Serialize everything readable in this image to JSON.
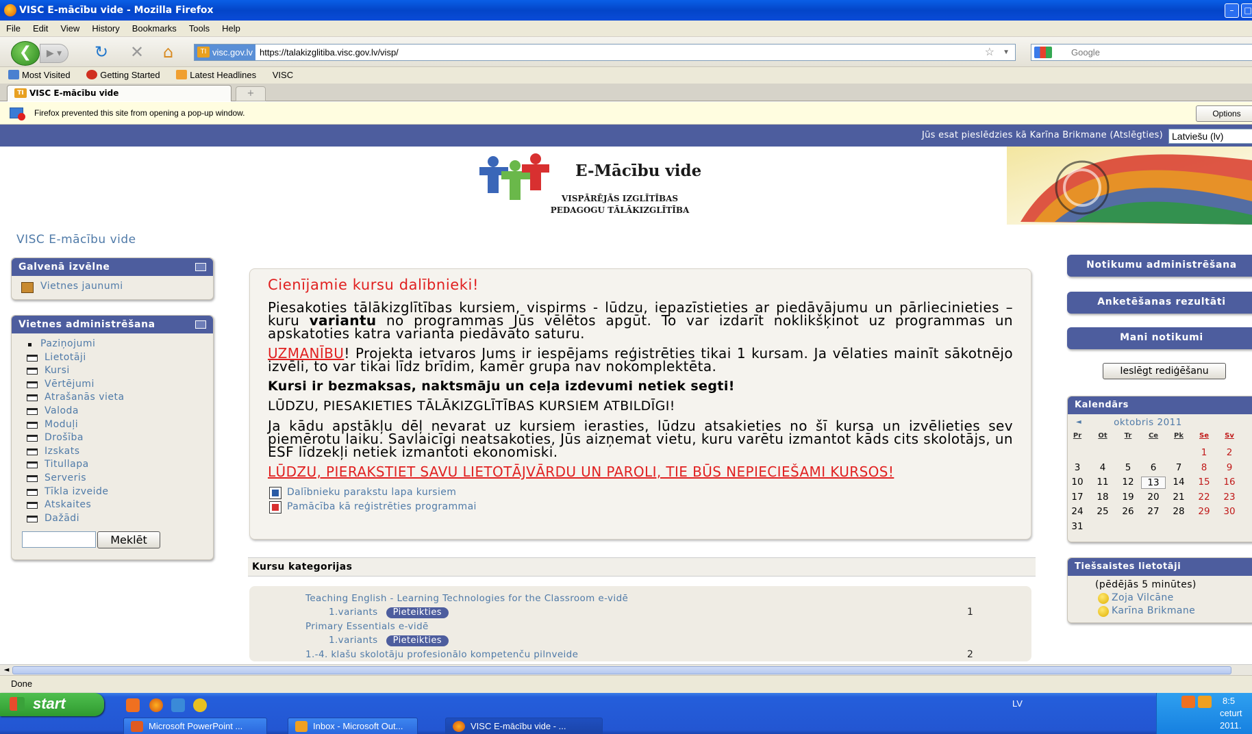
{
  "window": {
    "title": "VISC E-mācību vide - Mozilla Firefox"
  },
  "menubar": [
    "File",
    "Edit",
    "View",
    "History",
    "Bookmarks",
    "Tools",
    "Help"
  ],
  "navbar": {
    "site_badge": "visc.gov.lv",
    "url": "https://talakizglitiba.visc.gov.lv/visp/",
    "search_placeholder": "Google"
  },
  "bookmarks": [
    "Most Visited",
    "Getting Started",
    "Latest Headlines",
    "VISC"
  ],
  "tab": {
    "title": "VISC E-mācību vide",
    "new_tab": "+"
  },
  "popup": {
    "message": "Firefox prevented this site from opening a pop-up window.",
    "options_label": "Options"
  },
  "userbar": {
    "text": "Jūs esat pieslēdzies kā Karīna Brikmane (Atslēgties)",
    "language": "Latviešu (lv)"
  },
  "logo": {
    "title": "E-Mācību vide",
    "line1": "VISPĀRĒJĀS IZGLĪTĪBAS",
    "line2": "PEDAGOGU TĀLĀKIZGLĪTĪBA"
  },
  "site_title": "VISC E-mācību vide",
  "main_menu": {
    "title": "Galvenā izvēlne",
    "item": "Vietnes jaunumi"
  },
  "site_admin": {
    "title": "Vietnes administrēšana",
    "items": [
      "Paziņojumi",
      "Lietotāji",
      "Kursi",
      "Vērtējumi",
      "Atrašanās vieta",
      "Valoda",
      "Moduļi",
      "Drošība",
      "Izskats",
      "Titullapa",
      "Serveris",
      "Tīkla izveide",
      "Atskaites",
      "Dažādi"
    ],
    "search_button": "Meklēt"
  },
  "notice": {
    "heading": "Cienījamie kursu dalībnieki!",
    "p1_a": "Piesakoties tālākizglītības kursiem, vispirms - lūdzu, iepazīstieties ar piedāvājumu un pārliecinieties – kuru ",
    "p1_bold": "variantu",
    "p1_b": " no programmas Jūs vēlētos apgūt. To var izdarīt noklikšķinot uz programmas un apskatoties katra varianta piedāvāto saturu.",
    "p2_warn": "UZMANĪBU",
    "p2_rest": "! Projekta ietvaros Jums ir iespējams reģistrēties tikai 1 kursam. Ja vēlaties mainīt sākotnējo izvēli, to var tikai līdz brīdim, kamēr grupa nav nokomplektēta.",
    "p3": "Kursi ir bezmaksas, naktsmāju un ceļa izdevumi netiek segti!",
    "p4": "LŪDZU, PIESAKIETIES TĀLĀKIZGLĪTĪBAS KURSIEM ATBILDĪGI!",
    "p5": "Ja kādu apstākļu dēļ nevarat uz kursiem ierasties, lūdzu atsakieties no šī kursa un izvēlieties sev piemērotu laiku. Savlaicīgi neatsakoties, Jūs aizņemat vietu, kuru varētu izmantot kāds cits skolotājs, un ESF līdzekļi netiek izmantoti ekonomiski.",
    "p6": "LŪDZU, PIERAKSTIET SAVU LIETOTĀJVĀRDU UN PAROLI, TIE BŪS NEPIECIEŠAMI KURSOS!",
    "link1": "Dalībnieku parakstu lapa kursiem",
    "link2": "Pamācība kā reģistrēties programmai"
  },
  "categories": {
    "header": "Kursu kategorijas",
    "rows": [
      {
        "name": "Teaching English - Learning Technologies for the Classroom e-vidē",
        "variant": "1.variants",
        "button": "Pieteikties",
        "count": "1"
      },
      {
        "name": "Primary Essentials e-vidē",
        "variant": "1.variants",
        "button": "Pieteikties",
        "count": ""
      },
      {
        "name": "1.-4. klašu skolotāju profesionālo kompetenču pilnveide",
        "variant": "",
        "button": "",
        "count": "2"
      }
    ]
  },
  "right": {
    "btn1": "Notikumu administrēšana",
    "btn2": "Anketēšanas rezultāti",
    "btn3": "Mani notikumi",
    "edit": "Ieslēgt rediģēšanu"
  },
  "calendar": {
    "title": "Kalendārs",
    "prev": "◄",
    "month": "oktobris 2011",
    "days": [
      "Pr",
      "Ot",
      "Tr",
      "Ce",
      "Pk",
      "Se",
      "Sv"
    ],
    "weeks": [
      [
        "",
        "",
        "",
        "",
        "",
        "1",
        "2"
      ],
      [
        "3",
        "4",
        "5",
        "6",
        "7",
        "8",
        "9"
      ],
      [
        "10",
        "11",
        "12",
        "13",
        "14",
        "15",
        "16"
      ],
      [
        "17",
        "18",
        "19",
        "20",
        "21",
        "22",
        "23"
      ],
      [
        "24",
        "25",
        "26",
        "27",
        "28",
        "29",
        "30"
      ],
      [
        "31",
        "",
        "",
        "",
        "",
        "",
        ""
      ]
    ],
    "today": "13"
  },
  "online": {
    "title": "Tiešsaistes lietotāji",
    "subtitle": "(pēdējās 5 minūtes)",
    "users": [
      "Zoja Vilcāne",
      "Karīna Brikmane"
    ]
  },
  "status": "Done",
  "taskbar": {
    "start": "start",
    "tasks": [
      "Microsoft PowerPoint ...",
      "Inbox - Microsoft Out...",
      "VISC E-mācību vide - ..."
    ],
    "lang": "LV",
    "clock": "8:5",
    "day": "ceturt",
    "date": "2011."
  }
}
